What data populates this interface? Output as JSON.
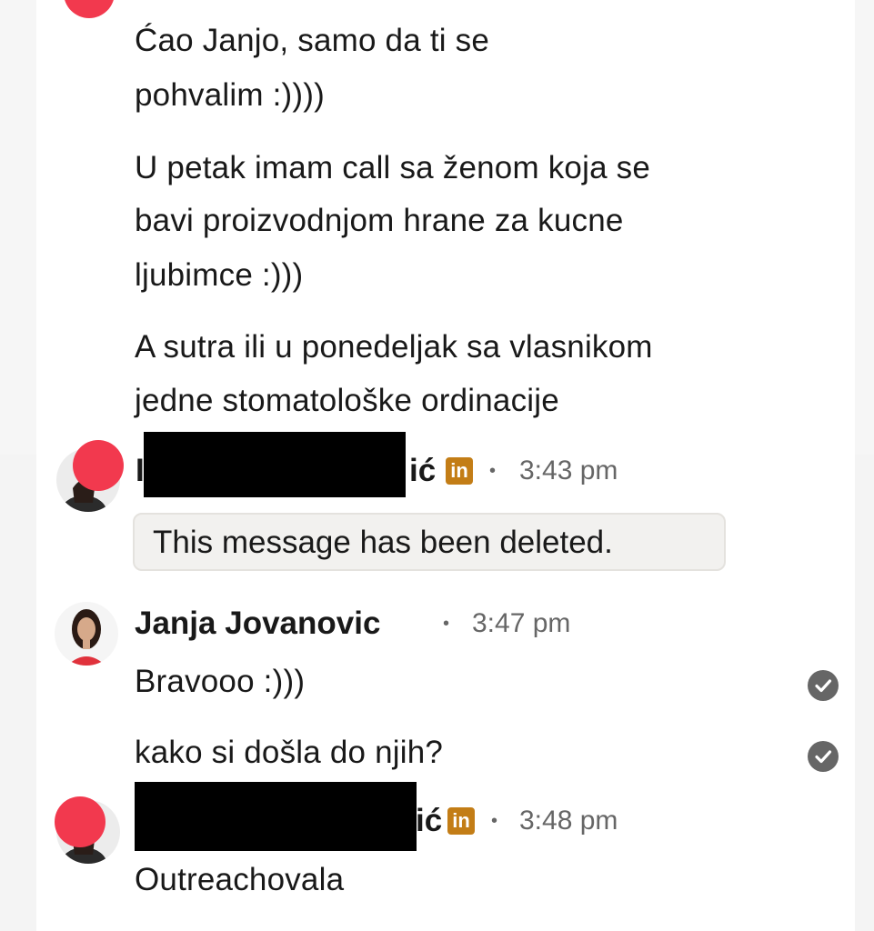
{
  "conversation": {
    "first_block": {
      "lines": [
        "Ćao Janjo, samo da ti se",
        "pohvalim :))))",
        "U petak imam call sa ženom koja se",
        "bavi proizvodnjom hrane za kucne",
        "ljubimce :)))",
        "A sutra ili u ponedeljak sa vlasnikom",
        "jedne stomatološke ordinacije"
      ]
    },
    "group_2": {
      "sender_visible_suffix": "ić",
      "sender_visible_prefix": "I",
      "linkedin_badge": "in",
      "separator": "•",
      "time": "3:43 pm",
      "deleted_notice": "This message has been deleted."
    },
    "group_3": {
      "sender": "Janja Jovanovic",
      "separator": "•",
      "time": "3:47 pm",
      "messages": [
        "Bravooo :)))",
        "kako si došla do njih?"
      ],
      "read_receipt_icon": "check-circle-icon"
    },
    "group_4": {
      "sender_visible_suffix": "ić",
      "linkedin_badge": "in",
      "separator": "•",
      "time": "3:48 pm",
      "messages": [
        "Outreachovala"
      ]
    }
  },
  "colors": {
    "redaction_dot": "#f2394e",
    "linkedin_badge": "#c37d16",
    "meta_text": "#666666"
  }
}
